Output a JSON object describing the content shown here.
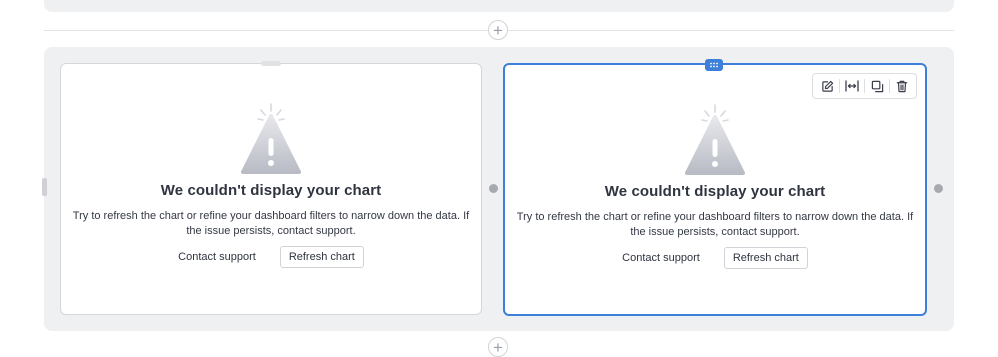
{
  "cards": [
    {
      "title": "We couldn't display your chart",
      "description": "Try to refresh the chart or refine your dashboard filters to narrow down the data. If the issue persists, contact support.",
      "contact_label": "Contact support",
      "refresh_label": "Refresh chart",
      "selected": false
    },
    {
      "title": "We couldn't display your chart",
      "description": "Try to refresh the chart or refine your dashboard filters to narrow down the data. If the issue persists, contact support.",
      "contact_label": "Contact support",
      "refresh_label": "Refresh chart",
      "selected": true
    }
  ],
  "toolbar": {
    "icons": [
      "edit-icon",
      "resize-width-icon",
      "duplicate-icon",
      "delete-icon"
    ]
  },
  "colors": {
    "accent": "#3d7fd9",
    "section_bg": "#eff0f1",
    "warning_icon": "#c9ccd3"
  }
}
